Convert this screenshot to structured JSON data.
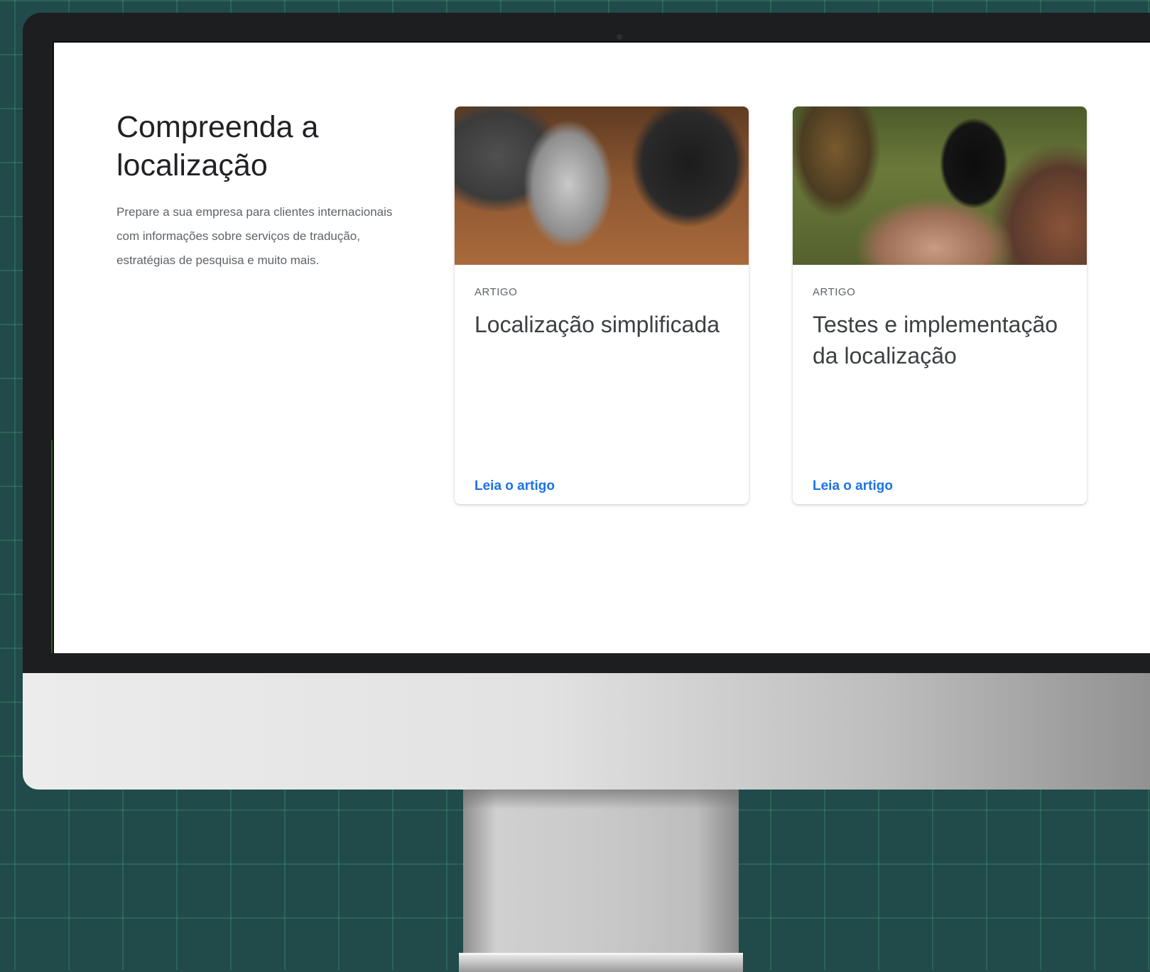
{
  "intro": {
    "title": "Compreenda a localização",
    "description": "Prepare a sua empresa para clientes internacionais com informações sobre serviços de tradução, estratégias de pesquisa e muito mais."
  },
  "cards": [
    {
      "eyebrow": "ARTIGO",
      "title": "Localização simplificada",
      "link": "Leia o artigo",
      "image": "team-with-tablet-photo"
    },
    {
      "eyebrow": "ARTIGO",
      "title": "Testes e implementação da localização",
      "link": "Leia o artigo",
      "image": "people-with-smartphone-photo"
    }
  ],
  "colors": {
    "background": "#214a4b",
    "link": "#1a73e8",
    "heading": "#202124"
  }
}
